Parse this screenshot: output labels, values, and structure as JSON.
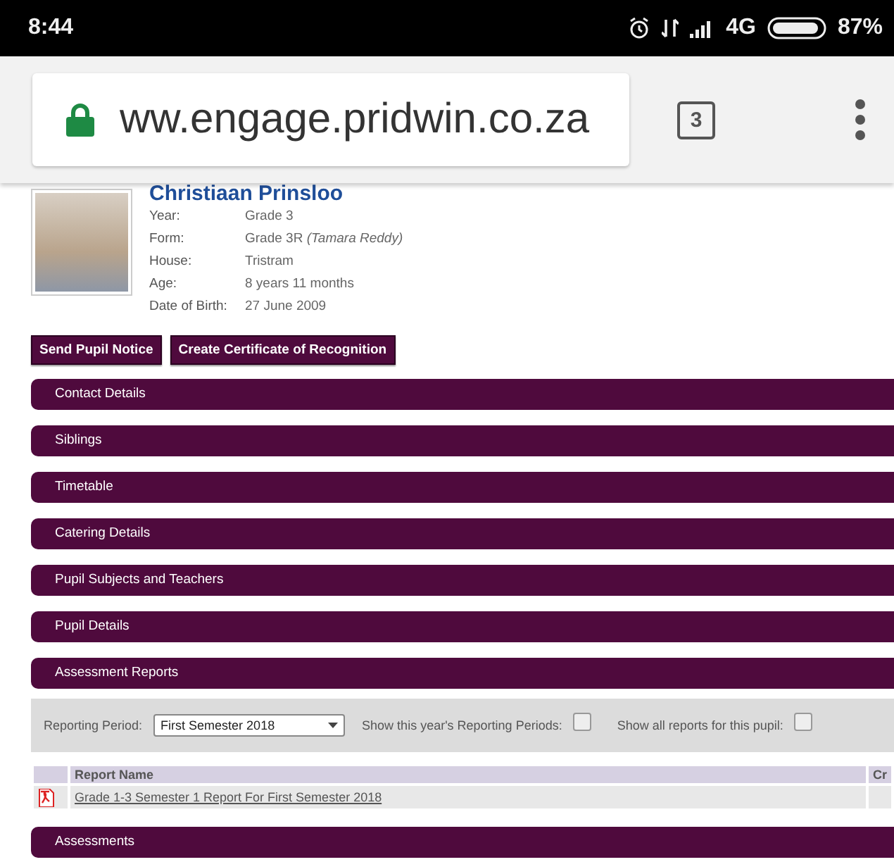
{
  "status_bar": {
    "time": "8:44",
    "network": "4G",
    "battery": "87%"
  },
  "browser": {
    "url": "ww.engage.pridwin.co.za",
    "tab_count": "3"
  },
  "pupil": {
    "name": "Christiaan Prinsloo",
    "fields": [
      {
        "label": "Year:",
        "value": "Grade 3"
      },
      {
        "label": "Form:",
        "value": "Grade 3R *(Tamara Reddy)*"
      },
      {
        "label": "House:",
        "value": "Tristram"
      },
      {
        "label": "Age:",
        "value": "8 years 11 months"
      },
      {
        "label": "Date of Birth:",
        "value": "27 June 2009"
      }
    ]
  },
  "actions": [
    "Send Pupil Notice",
    "Create Certificate of Recognition"
  ],
  "sections": [
    {
      "title": "Contact Details"
    },
    {
      "title": "Siblings"
    },
    {
      "title": "Timetable"
    },
    {
      "title": "Catering Details"
    },
    {
      "title": "Pupil Subjects and Teachers"
    },
    {
      "title": "Pupil Details"
    },
    {
      "title": "Assessment Reports",
      "report_panel": {
        "period_label": "Reporting Period:",
        "period_value": "First Semester 2018",
        "filters": [
          {
            "label": "Show this year's Reporting Periods:",
            "checked": false
          },
          {
            "label": "Show all reports for this pupil:",
            "checked": false
          }
        ],
        "columns": [
          "Report Name",
          "Cr"
        ],
        "rows": [
          {
            "name": "Grade 1-3 Semester 1 Report For First Semester 2018"
          }
        ]
      }
    },
    {
      "title": "Assessments"
    }
  ]
}
